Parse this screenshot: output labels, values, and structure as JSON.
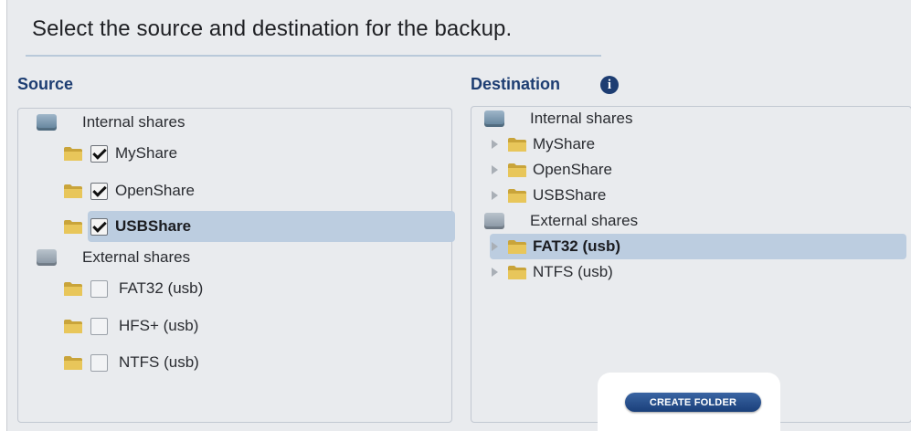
{
  "heading": "Select the source and destination for the backup.",
  "source": {
    "title": "Source",
    "internal_label": "Internal shares",
    "external_label": "External shares",
    "internal_items": [
      {
        "label": "MyShare",
        "checked": true
      },
      {
        "label": "OpenShare",
        "checked": true
      },
      {
        "label": "USBShare",
        "checked": true,
        "selected": true
      }
    ],
    "external_items": [
      {
        "label": "FAT32 (usb)",
        "checked": false
      },
      {
        "label": "HFS+ (usb)",
        "checked": false
      },
      {
        "label": "NTFS (usb)",
        "checked": false
      }
    ]
  },
  "destination": {
    "title": "Destination",
    "internal_label": "Internal shares",
    "external_label": "External shares",
    "internal_items": [
      {
        "label": "MyShare"
      },
      {
        "label": "OpenShare"
      },
      {
        "label": "USBShare"
      }
    ],
    "external_items": [
      {
        "label": "FAT32 (usb)",
        "selected": true
      },
      {
        "label": "NTFS (usb)"
      }
    ]
  },
  "create_folder_label": "CREATE FOLDER",
  "icons": {
    "info": "info-icon",
    "disk": "drive-icon",
    "folder": "folder-icon",
    "expander": "expand-arrow-icon"
  },
  "colors": {
    "title": "#1d3d72",
    "selection": "#bccde0",
    "button": "#1a3f7a"
  }
}
